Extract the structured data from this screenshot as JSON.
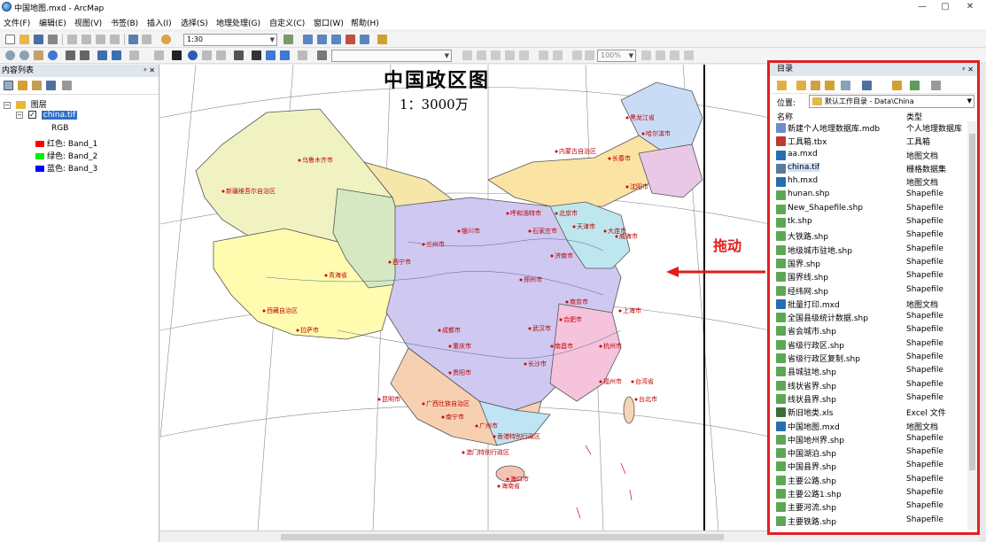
{
  "window": {
    "title": "中国地图.mxd - ArcMap",
    "minimize": "—",
    "maximize": "▢",
    "close": "✕"
  },
  "menu": [
    "文件(F)",
    "编辑(E)",
    "视图(V)",
    "书签(B)",
    "插入(I)",
    "选择(S)",
    "地理处理(G)",
    "自定义(C)",
    "窗口(W)",
    "帮助(H)"
  ],
  "toolbar": {
    "scale": "1:30",
    "zoom": "100%"
  },
  "toc": {
    "title": "内容列表",
    "group": "图层",
    "layer": "china.tif",
    "renderer": "RGB",
    "bands": [
      {
        "label": "红色:   Band_1",
        "color": "#ff0000"
      },
      {
        "label": "绿色: Band_2",
        "color": "#00ee00"
      },
      {
        "label": "蓝色:   Band_3",
        "color": "#0000ff"
      }
    ]
  },
  "map": {
    "title": "中国政区图",
    "scale": "1：3000万",
    "labels": [
      "乌鲁木齐市",
      "新疆维吾尔自治区",
      "西藏自治区",
      "拉萨市",
      "青海省",
      "西宁市",
      "兰州市",
      "银川市",
      "呼和浩特市",
      "北京市",
      "天津市",
      "哈尔滨市",
      "长春市",
      "沈阳市",
      "黑龙江省",
      "内蒙古自治区",
      "上海市",
      "成都市",
      "昆明市",
      "南宁市",
      "广州市",
      "海口市",
      "台北市",
      "杭州市",
      "福州市",
      "大连市",
      "威海市",
      "济南市",
      "郑州市",
      "长沙市",
      "武汉市",
      "贵阳市",
      "重庆市",
      "南京市",
      "合肥市",
      "石家庄市",
      "南昌市",
      "广西壮族自治区",
      "澳门特别行政区",
      "香港特别行政区",
      "海南省",
      "台湾省"
    ]
  },
  "annotation": {
    "text": "拖动",
    "color": "#e11b1b"
  },
  "catalog": {
    "title": "目录",
    "location_label": "位置:",
    "location_value": "默认工作目录 - Data\\China",
    "col_name": "名称",
    "col_type": "类型",
    "items": [
      {
        "name": "新建个人地理数据库.mdb",
        "type": "个人地理数据库",
        "icon": "database-icon",
        "color": "#6a8fc9"
      },
      {
        "name": "工具箱.tbx",
        "type": "工具箱",
        "icon": "toolbox-icon",
        "color": "#c0392b"
      },
      {
        "name": "aa.mxd",
        "type": "地图文档",
        "icon": "map-document-icon",
        "color": "#2a6cb0"
      },
      {
        "name": "china.tif",
        "type": "栅格数据集",
        "icon": "raster-icon",
        "color": "#5d7a9c"
      },
      {
        "name": "hh.mxd",
        "type": "地图文档",
        "icon": "map-document-icon",
        "color": "#2a6cb0"
      },
      {
        "name": "hunan.shp",
        "type": "Shapefile",
        "icon": "polygon-shapefile-icon",
        "color": "#5ca854"
      },
      {
        "name": "New_Shapefile.shp",
        "type": "Shapefile",
        "icon": "point-shapefile-icon",
        "color": "#5ca854"
      },
      {
        "name": "tk.shp",
        "type": "Shapefile",
        "icon": "point-shapefile-icon",
        "color": "#5ca854"
      },
      {
        "name": "大铁路.shp",
        "type": "Shapefile",
        "icon": "line-shapefile-icon",
        "color": "#5ca854"
      },
      {
        "name": "地级城市驻地.shp",
        "type": "Shapefile",
        "icon": "point-shapefile-icon",
        "color": "#5ca854"
      },
      {
        "name": "国界.shp",
        "type": "Shapefile",
        "icon": "polygon-shapefile-icon",
        "color": "#5ca854"
      },
      {
        "name": "国界线.shp",
        "type": "Shapefile",
        "icon": "line-shapefile-icon",
        "color": "#5ca854"
      },
      {
        "name": "经纬网.shp",
        "type": "Shapefile",
        "icon": "line-shapefile-icon",
        "color": "#5ca854"
      },
      {
        "name": "批量打印.mxd",
        "type": "地图文档",
        "icon": "map-document-icon",
        "color": "#2a6cb0"
      },
      {
        "name": "全国县级统计数据.shp",
        "type": "Shapefile",
        "icon": "polygon-shapefile-icon",
        "color": "#5ca854"
      },
      {
        "name": "省会城市.shp",
        "type": "Shapefile",
        "icon": "point-shapefile-icon",
        "color": "#5ca854"
      },
      {
        "name": "省级行政区.shp",
        "type": "Shapefile",
        "icon": "polygon-shapefile-icon",
        "color": "#5ca854"
      },
      {
        "name": "省级行政区复制.shp",
        "type": "Shapefile",
        "icon": "polygon-shapefile-icon",
        "color": "#5ca854"
      },
      {
        "name": "县城驻地.shp",
        "type": "Shapefile",
        "icon": "point-shapefile-icon",
        "color": "#5ca854"
      },
      {
        "name": "线状省界.shp",
        "type": "Shapefile",
        "icon": "line-shapefile-icon",
        "color": "#5ca854"
      },
      {
        "name": "线状县界.shp",
        "type": "Shapefile",
        "icon": "line-shapefile-icon",
        "color": "#5ca854"
      },
      {
        "name": "新旧地类.xls",
        "type": "Excel 文件",
        "icon": "table-icon",
        "color": "#3c6e3c"
      },
      {
        "name": "中国地图.mxd",
        "type": "地图文档",
        "icon": "map-document-icon",
        "color": "#2a6cb0"
      },
      {
        "name": "中国地州界.shp",
        "type": "Shapefile",
        "icon": "polygon-shapefile-icon",
        "color": "#5ca854"
      },
      {
        "name": "中国湖泊.shp",
        "type": "Shapefile",
        "icon": "polygon-shapefile-icon",
        "color": "#5ca854"
      },
      {
        "name": "中国县界.shp",
        "type": "Shapefile",
        "icon": "polygon-shapefile-icon",
        "color": "#5ca854"
      },
      {
        "name": "主要公路.shp",
        "type": "Shapefile",
        "icon": "line-shapefile-icon",
        "color": "#5ca854"
      },
      {
        "name": "主要公路1.shp",
        "type": "Shapefile",
        "icon": "line-shapefile-icon",
        "color": "#5ca854"
      },
      {
        "name": "主要河流.shp",
        "type": "Shapefile",
        "icon": "line-shapefile-icon",
        "color": "#5ca854"
      },
      {
        "name": "主要铁路.shp",
        "type": "Shapefile",
        "icon": "line-shapefile-icon",
        "color": "#5ca854"
      }
    ]
  }
}
